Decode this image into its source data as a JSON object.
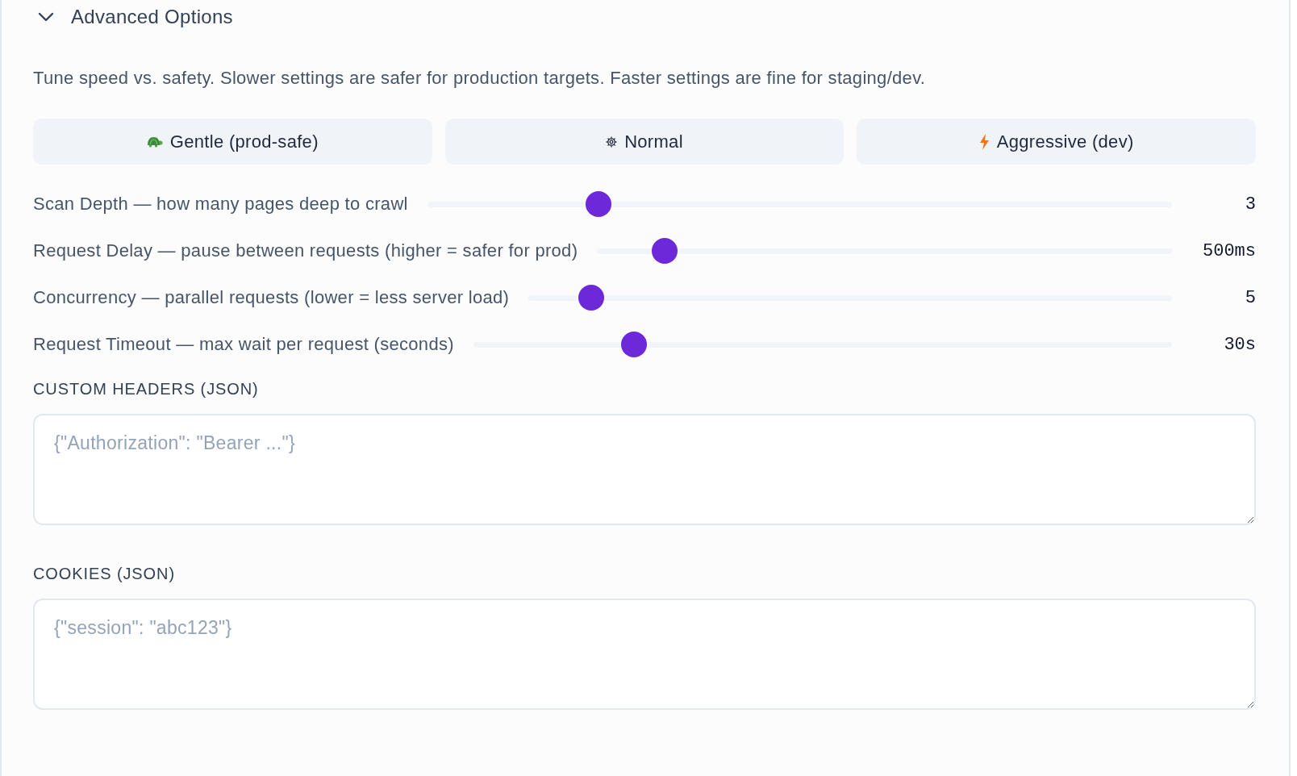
{
  "section": {
    "title": "Advanced Options",
    "expanded": true
  },
  "description": "Tune speed vs. safety. Slower settings are safer for production targets. Faster settings are fine for staging/dev.",
  "presets": [
    {
      "label": "Gentle (prod-safe)"
    },
    {
      "label": "Normal"
    },
    {
      "label": "Aggressive (dev)"
    }
  ],
  "sliders": [
    {
      "label": "Scan Depth — how many pages deep to crawl",
      "level": 0.22,
      "reading": "3"
    },
    {
      "label": "Request Delay — pause between requests (higher = safer for prod)",
      "level": 0.1,
      "reading": "500ms"
    },
    {
      "label": "Concurrency — parallel requests (lower = less server load)",
      "level": 0.08,
      "reading": "5"
    },
    {
      "label": "Request Timeout — max wait per request (seconds)",
      "level": 0.22,
      "reading": "30s"
    }
  ],
  "fields": [
    {
      "label": "CUSTOM HEADERS (JSON)",
      "placeholder": "{\"Authorization\": \"Bearer ...\"}"
    },
    {
      "label": "COOKIES (JSON)",
      "placeholder": "{\"session\": \"abc123\"}"
    }
  ]
}
